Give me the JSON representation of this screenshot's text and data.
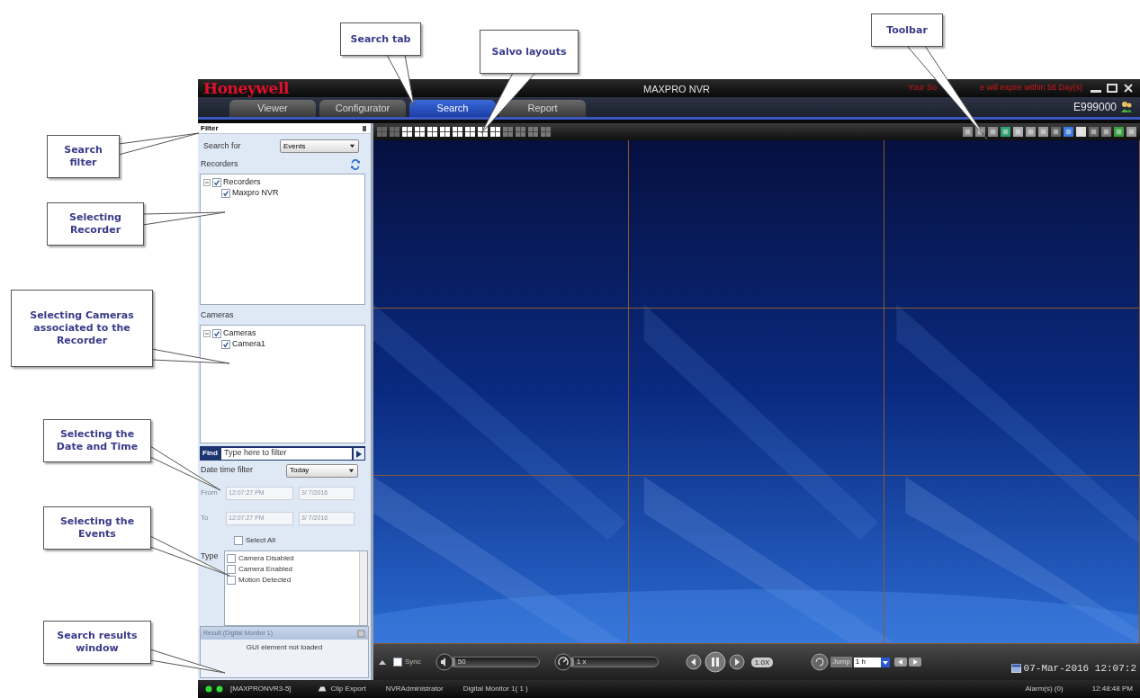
{
  "callouts": [
    {
      "text": "Search tab"
    },
    {
      "text": "Salvo layouts"
    },
    {
      "text": "Toolbar"
    },
    {
      "text": "Search filter"
    },
    {
      "text": "Selecting Recorder"
    },
    {
      "text": "Selecting Cameras associated to the Recorder"
    },
    {
      "text": "Selecting the Date and Time"
    },
    {
      "text": "Selecting the Events"
    },
    {
      "text": "Search results window"
    }
  ],
  "title_bar": {
    "logo": "Honeywell",
    "title": "MAXPRO NVR",
    "notice_parts": [
      "Your So",
      "e will expire within 56 Day(s)"
    ]
  },
  "tabs": [
    {
      "label": "Viewer",
      "selected": false
    },
    {
      "label": "Configurator",
      "selected": false
    },
    {
      "label": "Search",
      "selected": true
    },
    {
      "label": "Report",
      "selected": false
    }
  ],
  "user": "E999000",
  "filter_panel": {
    "title": "Filter",
    "search_for": {
      "label": "Search for",
      "value": "Events"
    },
    "recorders": {
      "heading": "Recorders",
      "tree": [
        {
          "label": "Recorders",
          "checked": true,
          "expanded": true,
          "children": [
            {
              "label": "Maxpro NVR",
              "checked": true
            }
          ]
        }
      ]
    },
    "cameras": {
      "heading": "Cameras",
      "tree": [
        {
          "label": "Cameras",
          "checked": true,
          "expanded": true,
          "children": [
            {
              "label": "Camera1",
              "checked": true
            }
          ]
        }
      ]
    },
    "find": {
      "label": "Find",
      "placeholder": "Type here to filter"
    },
    "date_time_filter": {
      "label": "Date time filter",
      "value": "Today"
    },
    "from": {
      "label": "From",
      "time": "12:07:27 PM",
      "date": "3/ 7/2016"
    },
    "to": {
      "label": "To",
      "time": "12:07:27 PM",
      "date": "3/ 7/2016"
    },
    "select_all": {
      "label": "Select All",
      "checked": false
    },
    "type": {
      "label": "Type",
      "items": [
        {
          "label": "Camera Disabled",
          "checked": false
        },
        {
          "label": "Camera Enabled",
          "checked": false
        },
        {
          "label": "Motion Detected",
          "checked": false
        }
      ]
    }
  },
  "result": {
    "title": "Result (Digital Monitor 1)",
    "message": "GUI element not loaded"
  },
  "playback": {
    "sync": {
      "label": "Sync",
      "checked": false
    },
    "volume": {
      "reading": "50",
      "level": 0.05
    },
    "speed": {
      "reading": "1 x",
      "level": 0.05
    },
    "rate": "1.0X",
    "jump": {
      "label": "Jump",
      "value": "1 h"
    },
    "datetime": "07-Mar-2016 12:07:2"
  },
  "status_bar": {
    "server": "[MAXPRONVR3-5]",
    "items": [
      "Clip Export",
      "NVRAdministrator",
      "Digital Monitor 1( 1 )"
    ],
    "alarms": "Alarm(s) (0)",
    "time": "12:48:48 PM"
  }
}
